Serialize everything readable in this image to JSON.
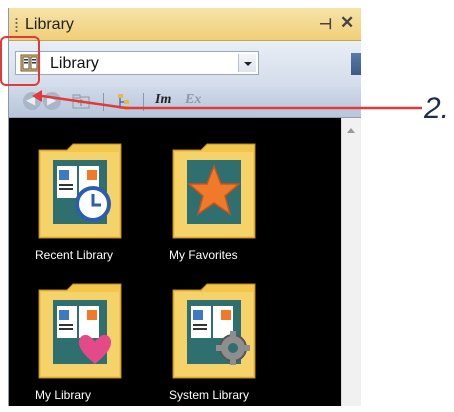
{
  "panel": {
    "title": "Library",
    "pin_glyph": "⊣",
    "close_glyph": "✕"
  },
  "selector": {
    "value": "Library",
    "icon": "library-book-icon"
  },
  "toolbar": {
    "buttons": [
      {
        "icon": "back-arrow-icon",
        "enabled": false
      },
      {
        "icon": "forward-arrow-icon",
        "enabled": false
      },
      {
        "icon": "up-folder-icon",
        "enabled": false
      },
      {
        "icon": "tree-view-icon",
        "enabled": true
      },
      {
        "label": "Im",
        "enabled": true
      },
      {
        "label": "Ex",
        "enabled": false
      }
    ]
  },
  "items": [
    {
      "label": "Recent Library",
      "icon": "recent-library-icon"
    },
    {
      "label": "My Favorites",
      "icon": "favorites-star-icon"
    },
    {
      "label": "My Library",
      "icon": "my-library-heart-icon"
    },
    {
      "label": "System Library",
      "icon": "system-library-gear-icon"
    }
  ],
  "callout": {
    "number": "2.",
    "color": "#e23a3a"
  }
}
